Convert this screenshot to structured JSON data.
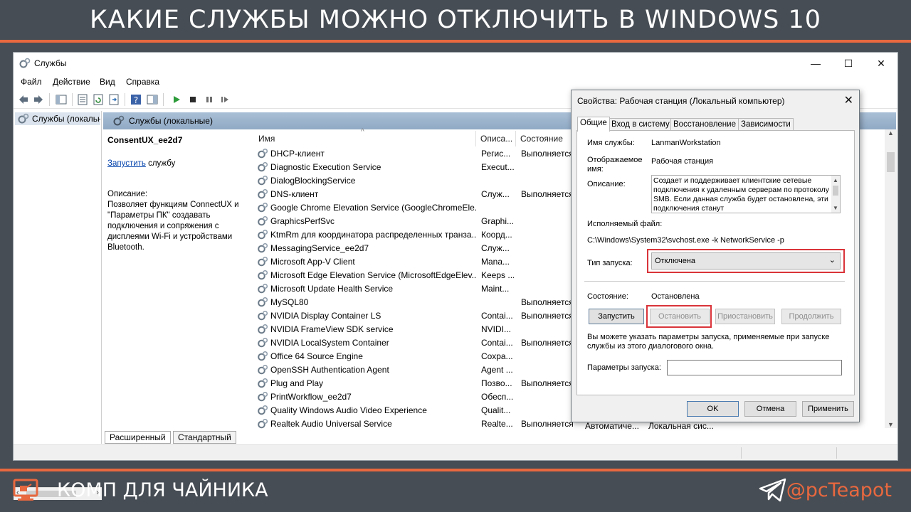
{
  "banner": {
    "title": "КАКИЕ СЛУЖБЫ МОЖНО ОТКЛЮЧИТЬ В WINDOWS 10"
  },
  "footer": {
    "brand": "КОМП ДЛЯ ЧАЙНИКА",
    "handle": "@pcTeapot"
  },
  "window": {
    "title": "Службы",
    "controls": {
      "minimize": "—",
      "maximize": "☐",
      "close": "✕"
    },
    "menu": [
      "Файл",
      "Действие",
      "Вид",
      "Справка"
    ]
  },
  "tree": {
    "selected": "Службы (локальные)"
  },
  "pane": {
    "header": "Службы (локальные)"
  },
  "details": {
    "service": "ConsentUX_ee2d7",
    "start_link": "Запустить",
    "start_suffix": " службу",
    "desc_label": "Описание:",
    "desc_text": "Позволяет функциям ConnectUX и \"Параметры ПК\" создавать подключения и сопряжения с дисплеями Wi-Fi и устройствами Bluetooth."
  },
  "list": {
    "columns": {
      "name": "Имя",
      "desc": "Описа...",
      "status": "Состояние"
    },
    "rows": [
      {
        "name": "DHCP-клиент",
        "desc": "Регис...",
        "status": "Выполняется"
      },
      {
        "name": "Diagnostic Execution Service",
        "desc": "Execut...",
        "status": ""
      },
      {
        "name": "DialogBlockingService",
        "desc": "",
        "status": ""
      },
      {
        "name": "DNS-клиент",
        "desc": "Служ...",
        "status": "Выполняется"
      },
      {
        "name": "Google Chrome Elevation Service (GoogleChromeEle...",
        "desc": "",
        "status": ""
      },
      {
        "name": "GraphicsPerfSvc",
        "desc": "Graphi...",
        "status": ""
      },
      {
        "name": "KtmRm для координатора распределенных транза...",
        "desc": "Коорд...",
        "status": ""
      },
      {
        "name": "MessagingService_ee2d7",
        "desc": "Служ...",
        "status": ""
      },
      {
        "name": "Microsoft App-V Client",
        "desc": "Mana...",
        "status": ""
      },
      {
        "name": "Microsoft Edge Elevation Service (MicrosoftEdgeElev...",
        "desc": "Keeps ...",
        "status": ""
      },
      {
        "name": "Microsoft Update Health Service",
        "desc": "Maint...",
        "status": ""
      },
      {
        "name": "MySQL80",
        "desc": "",
        "status": "Выполняется"
      },
      {
        "name": "NVIDIA Display Container LS",
        "desc": "Contai...",
        "status": "Выполняется"
      },
      {
        "name": "NVIDIA FrameView SDK service",
        "desc": "NVIDI...",
        "status": ""
      },
      {
        "name": "NVIDIA LocalSystem Container",
        "desc": "Contai...",
        "status": "Выполняется"
      },
      {
        "name": "Office 64 Source Engine",
        "desc": "Сохра...",
        "status": ""
      },
      {
        "name": "OpenSSH Authentication Agent",
        "desc": "Agent ...",
        "status": ""
      },
      {
        "name": "Plug and Play",
        "desc": "Позво...",
        "status": "Выполняется"
      },
      {
        "name": "PrintWorkflow_ee2d7",
        "desc": "Обесп...",
        "status": ""
      },
      {
        "name": "Quality Windows Audio Video Experience",
        "desc": "Qualit...",
        "status": ""
      },
      {
        "name": "Realtek Audio Universal Service",
        "desc": "Realte...",
        "status": "Выполняется"
      }
    ],
    "last_row_extra": {
      "startup": "Автоматиче...",
      "logon": "Локальная сис..."
    }
  },
  "bottom_tabs": [
    "Расширенный",
    "Стандартный"
  ],
  "dialog": {
    "title": "Свойства: Рабочая станция (Локальный компьютер)",
    "close": "✕",
    "tabs": [
      "Общие",
      "Вход в систему",
      "Восстановление",
      "Зависимости"
    ],
    "service_name_label": "Имя службы:",
    "service_name": "LanmanWorkstation",
    "display_name_label": "Отображаемое имя:",
    "display_name": "Рабочая станция",
    "description_label": "Описание:",
    "description": "Создает и поддерживает клиентские сетевые подключения к удаленным серверам по протоколу SMB. Если данная служба будет остановлена, эти подключения станут",
    "exe_label": "Исполняемый файл:",
    "exe_path": "C:\\Windows\\System32\\svchost.exe -k NetworkService -p",
    "startup_label": "Тип запуска:",
    "startup_value": "Отключена",
    "status_label": "Состояние:",
    "status_value": "Остановлена",
    "buttons": {
      "start": "Запустить",
      "stop": "Остановить",
      "pause": "Приостановить",
      "resume": "Продолжить"
    },
    "hint": "Вы можете указать параметры запуска, применяемые при запуске службы из этого диалогового окна.",
    "params_label": "Параметры запуска:",
    "params_value": "",
    "footer": {
      "ok": "OK",
      "cancel": "Отмена",
      "apply": "Применить"
    }
  }
}
